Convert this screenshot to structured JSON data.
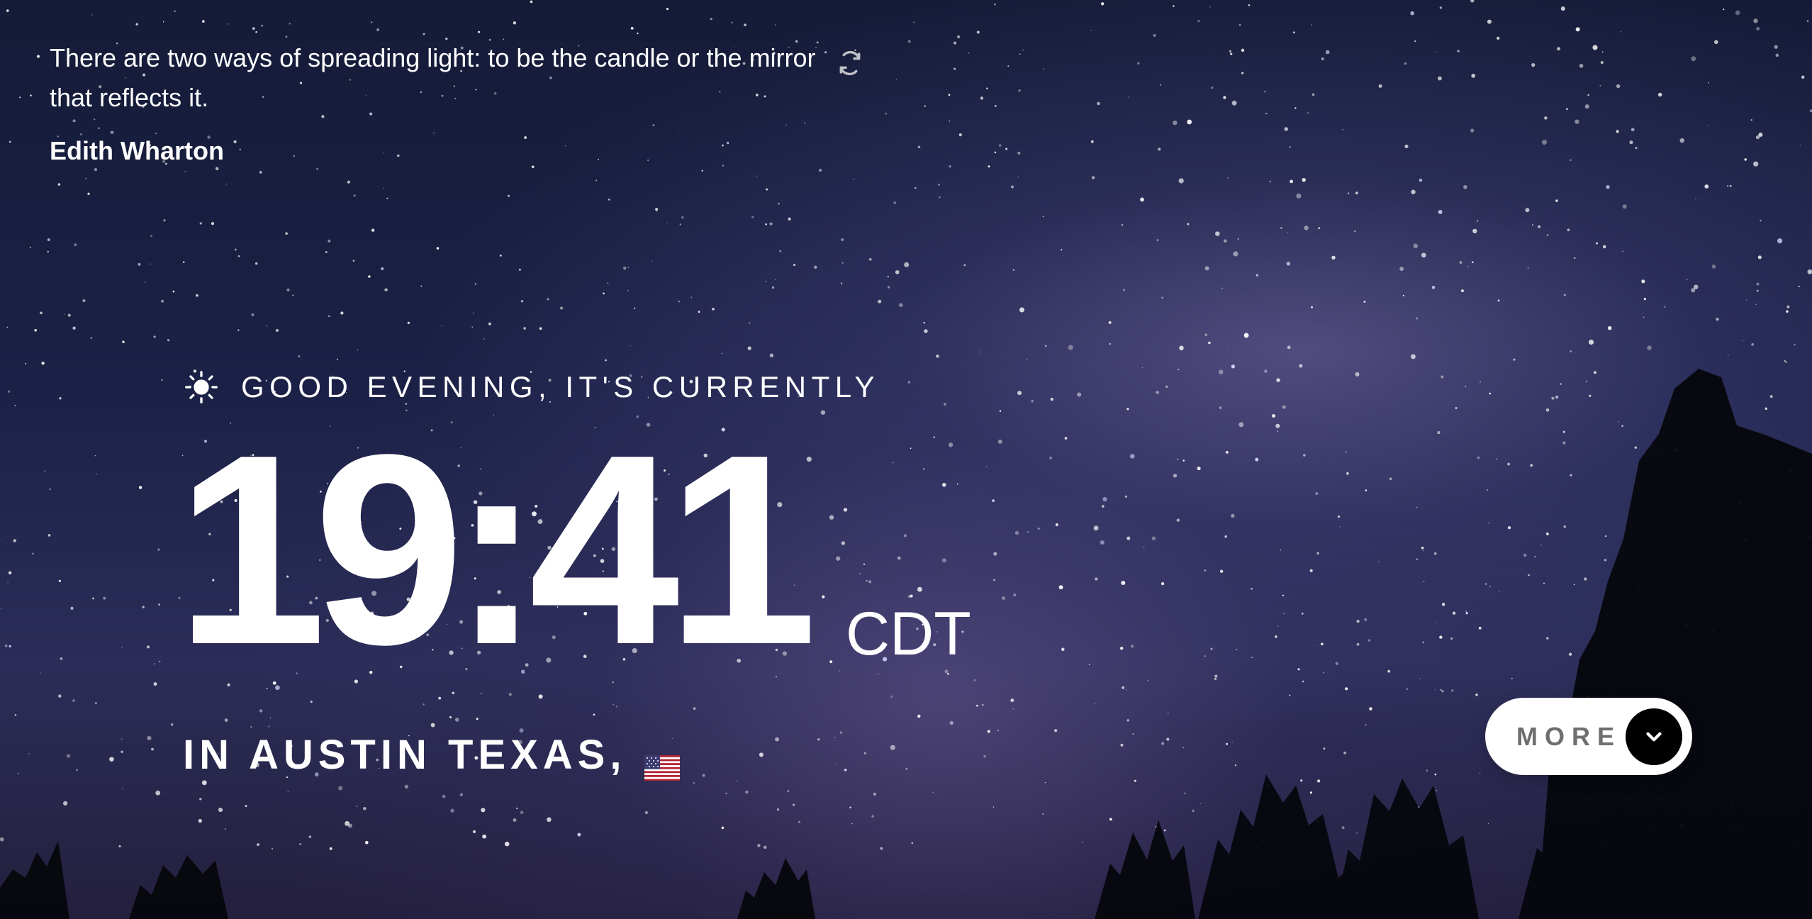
{
  "colors": {
    "text": "#ffffff",
    "button_background": "#ffffff",
    "button_text": "#6e6e6e",
    "chevron_background": "#000000",
    "sky_dark": "#151b37",
    "sky_purple": "#2b2d58"
  },
  "quote": {
    "text": "There are two ways of spreading light: to be the candle or the mirror that reflects it.",
    "author": "Edith Wharton",
    "refresh_icon": "refresh-icon"
  },
  "greeting": {
    "icon": "sun-icon",
    "text": "GOOD EVENING, IT'S CURRENTLY"
  },
  "clock": {
    "time": "19:41",
    "timezone": "CDT"
  },
  "location": {
    "text": "IN AUSTIN TEXAS,",
    "flag_icon": "us-flag-icon"
  },
  "more_button": {
    "label": "MORE",
    "icon": "chevron-down-icon"
  }
}
